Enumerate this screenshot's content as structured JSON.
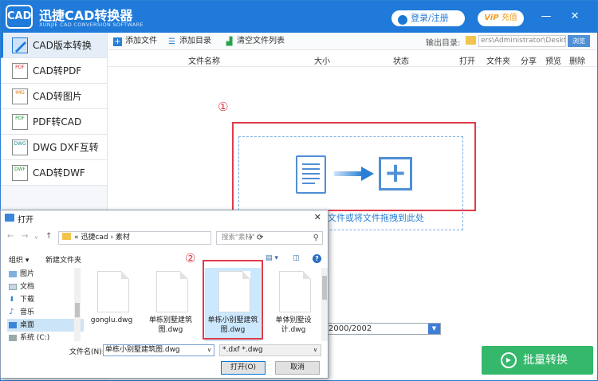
{
  "app": {
    "logo": "CAD",
    "title": "迅捷CAD转换器",
    "subtitle": "XUNJIE CAD CONVERSION SOFTWARE",
    "login": "登录/注册",
    "vip": "ViP",
    "recharge": "充值",
    "brand_color": "#1f7ad9"
  },
  "sidebar": {
    "items": [
      {
        "label": "CAD版本转换",
        "icon": "cad-version-icon"
      },
      {
        "label": "CAD转PDF",
        "icon": "pdf-icon"
      },
      {
        "label": "CAD转图片",
        "icon": "image-icon"
      },
      {
        "label": "PDF转CAD",
        "icon": "pdf-to-cad-icon"
      },
      {
        "label": "DWG DXF互转",
        "icon": "dwg-dxf-icon"
      },
      {
        "label": "CAD转DWF",
        "icon": "dwf-icon"
      }
    ]
  },
  "toolbar": {
    "add_file": "添加文件",
    "add_dir": "添加目录",
    "clear_list": "清空文件列表",
    "output_label": "输出目录:",
    "output_path": "ers\\Administrator\\Desktop",
    "browse": "浏览"
  },
  "table": {
    "headers": [
      "文件名称",
      "大小",
      "状态",
      "打开",
      "文件夹",
      "分享",
      "预览",
      "删除"
    ]
  },
  "drop": {
    "hint": "文件或将文件拖拽到此处",
    "marker1": "①",
    "marker2": "②"
  },
  "bottom": {
    "version": "2000/2002",
    "batch_label": "批量转换",
    "batch_color": "#35b86b"
  },
  "dialog": {
    "title": "打开",
    "breadcrumb_prefix": "«",
    "crumb1": "迅捷cad",
    "crumb2": "素材",
    "search_placeholder": "搜索\"素材\"",
    "organize": "组织 ▾",
    "new_folder": "新建文件夹",
    "tree": [
      "图片",
      "文档",
      "下载",
      "音乐",
      "桌面",
      "系统 (C:)"
    ],
    "files": [
      {
        "name": "gonglu.dwg"
      },
      {
        "name": "单栋别墅建筑图.dwg"
      },
      {
        "name": "单栋小别墅建筑图.dwg"
      },
      {
        "name": "单体别墅设计.dwg"
      }
    ],
    "filename_label": "文件名(N):",
    "filename_value": "单栋小别墅建筑图.dwg",
    "filter": "*.dxf *.dwg",
    "open": "打开(O)",
    "cancel": "取消"
  }
}
